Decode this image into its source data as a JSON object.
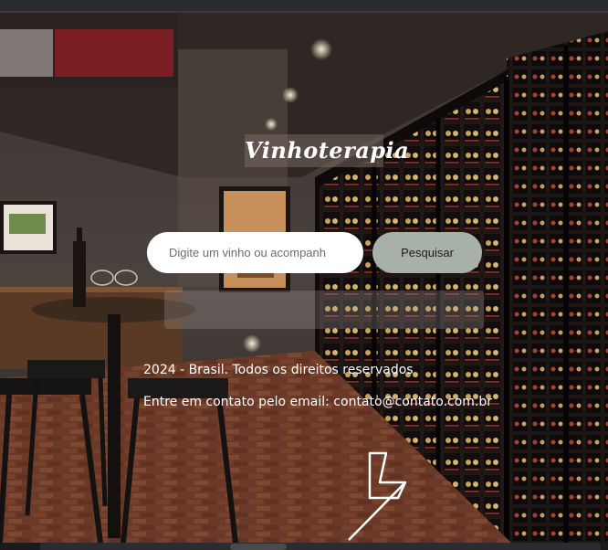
{
  "brand": {
    "title": "Vinhoterapia"
  },
  "search": {
    "placeholder": "Digite um vinho ou acompanh",
    "button_label": "Pesquisar"
  },
  "footer": {
    "copyright": "2024 - Brasil. Todos os direitos reservados",
    "contact": "Entre em contato pelo email: contato@contato.com.br"
  },
  "colors": {
    "button_bg": "#a7b0a9",
    "input_bg": "#ffffff",
    "text": "#ffffff"
  },
  "icons": {
    "bottom_logo": "lightning-logo-icon"
  }
}
